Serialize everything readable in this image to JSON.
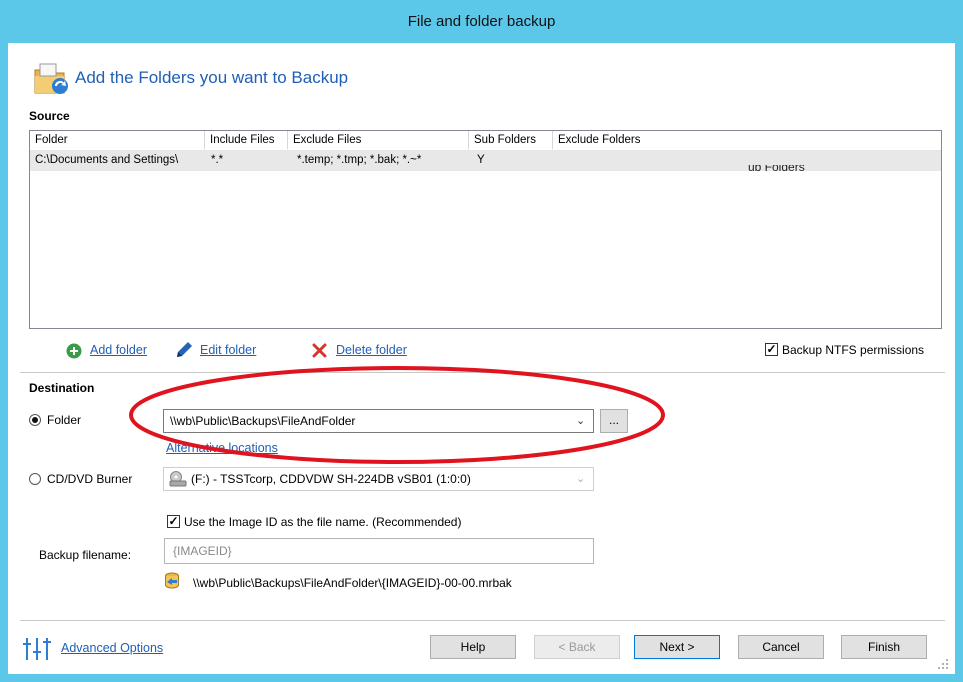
{
  "window": {
    "title": "File and folder backup"
  },
  "header": {
    "text": "Add the Folders you want to Backup"
  },
  "source": {
    "label": "Source",
    "columns": [
      "Folder",
      "Include Files",
      "Exclude Files",
      "Sub Folders",
      "Exclude Folders"
    ],
    "rows": [
      {
        "folder": "C:\\Documents and Settings\\",
        "include": "*.*",
        "exclude": "*.temp; *.tmp; *.bak; *.~*",
        "sub": "Y",
        "exclude_folders": ""
      }
    ],
    "overflow_fragment": "ub Folders",
    "actions": {
      "add": "Add folder",
      "edit": "Edit folder",
      "delete": "Delete folder"
    },
    "ntfs": {
      "label": "Backup NTFS permissions",
      "checked": true
    }
  },
  "destination": {
    "label": "Destination",
    "folder_option": {
      "label": "Folder",
      "selected": true
    },
    "folder_path": "\\\\wb\\Public\\Backups\\FileAndFolder",
    "browse_label": "...",
    "alt_link": "Alternative locations",
    "cd_option": {
      "label": "CD/DVD Burner",
      "selected": false
    },
    "cd_device": "(F:) - TSSTcorp, CDDVDW SH-224DB  vSB01 (1:0:0)",
    "use_image_id": {
      "label": "Use the Image ID as the file name.  (Recommended)",
      "checked": true
    },
    "filename_label": "Backup filename:",
    "filename_placeholder": "{IMAGEID}",
    "preview_path": "\\\\wb\\Public\\Backups\\FileAndFolder\\{IMAGEID}-00-00.mrbak"
  },
  "footer": {
    "advanced": "Advanced Options",
    "help": "Help",
    "back": "< Back",
    "next": "Next >",
    "cancel": "Cancel",
    "finish": "Finish"
  },
  "colors": {
    "titlebar": "#5bc8ea",
    "link": "#1f5fb5",
    "annotation": "#e0141e"
  }
}
